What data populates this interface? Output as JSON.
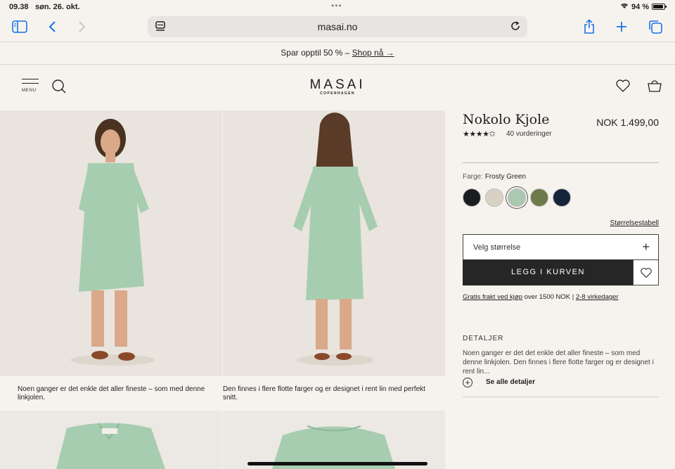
{
  "status": {
    "time": "09.38",
    "date": "søn. 26. okt.",
    "battery": "94 %"
  },
  "browser": {
    "url": "masai.no"
  },
  "promo": {
    "text": "Spar opptil 50 % – ",
    "link": "Shop nå →"
  },
  "header": {
    "menu_label": "MENU",
    "logo": "MASAI",
    "logo_sub": "COPENHAGEN"
  },
  "gallery": {
    "caption_1": "Noen ganger er det enkle det aller fineste – som med denne linkjolen.",
    "caption_2": "Den finnes i flere flotte farger og er designet i rent lin med perfekt snitt."
  },
  "product": {
    "title": "Nokolo Kjole",
    "price": "NOK 1.499,00",
    "rating_stars": "★★★★✩",
    "reviews": "40 vurderinger",
    "color_label": "Farge:",
    "color_value": "Frosty Green",
    "swatches": [
      "#1b1c1e",
      "#d8d2c5",
      "#a9c9b0",
      "#6e7a4a",
      "#14243a"
    ],
    "size_guide": "Størrelsestabell",
    "size_placeholder": "Velg størrelse",
    "add_to_cart": "LEGG I KURVEN",
    "shipping_link": "Gratis frakt ved kjøp",
    "shipping_text": " over 1500 NOK | ",
    "delivery_link": "2-8 virkedager",
    "details_heading": "DETALJER",
    "details_text": "Noen ganger er det det enkle det aller fineste – som med denne linkjolen. Den finnes i flere flotte farger og er designet i rent lin...",
    "see_all": "Se alle detaljer"
  }
}
